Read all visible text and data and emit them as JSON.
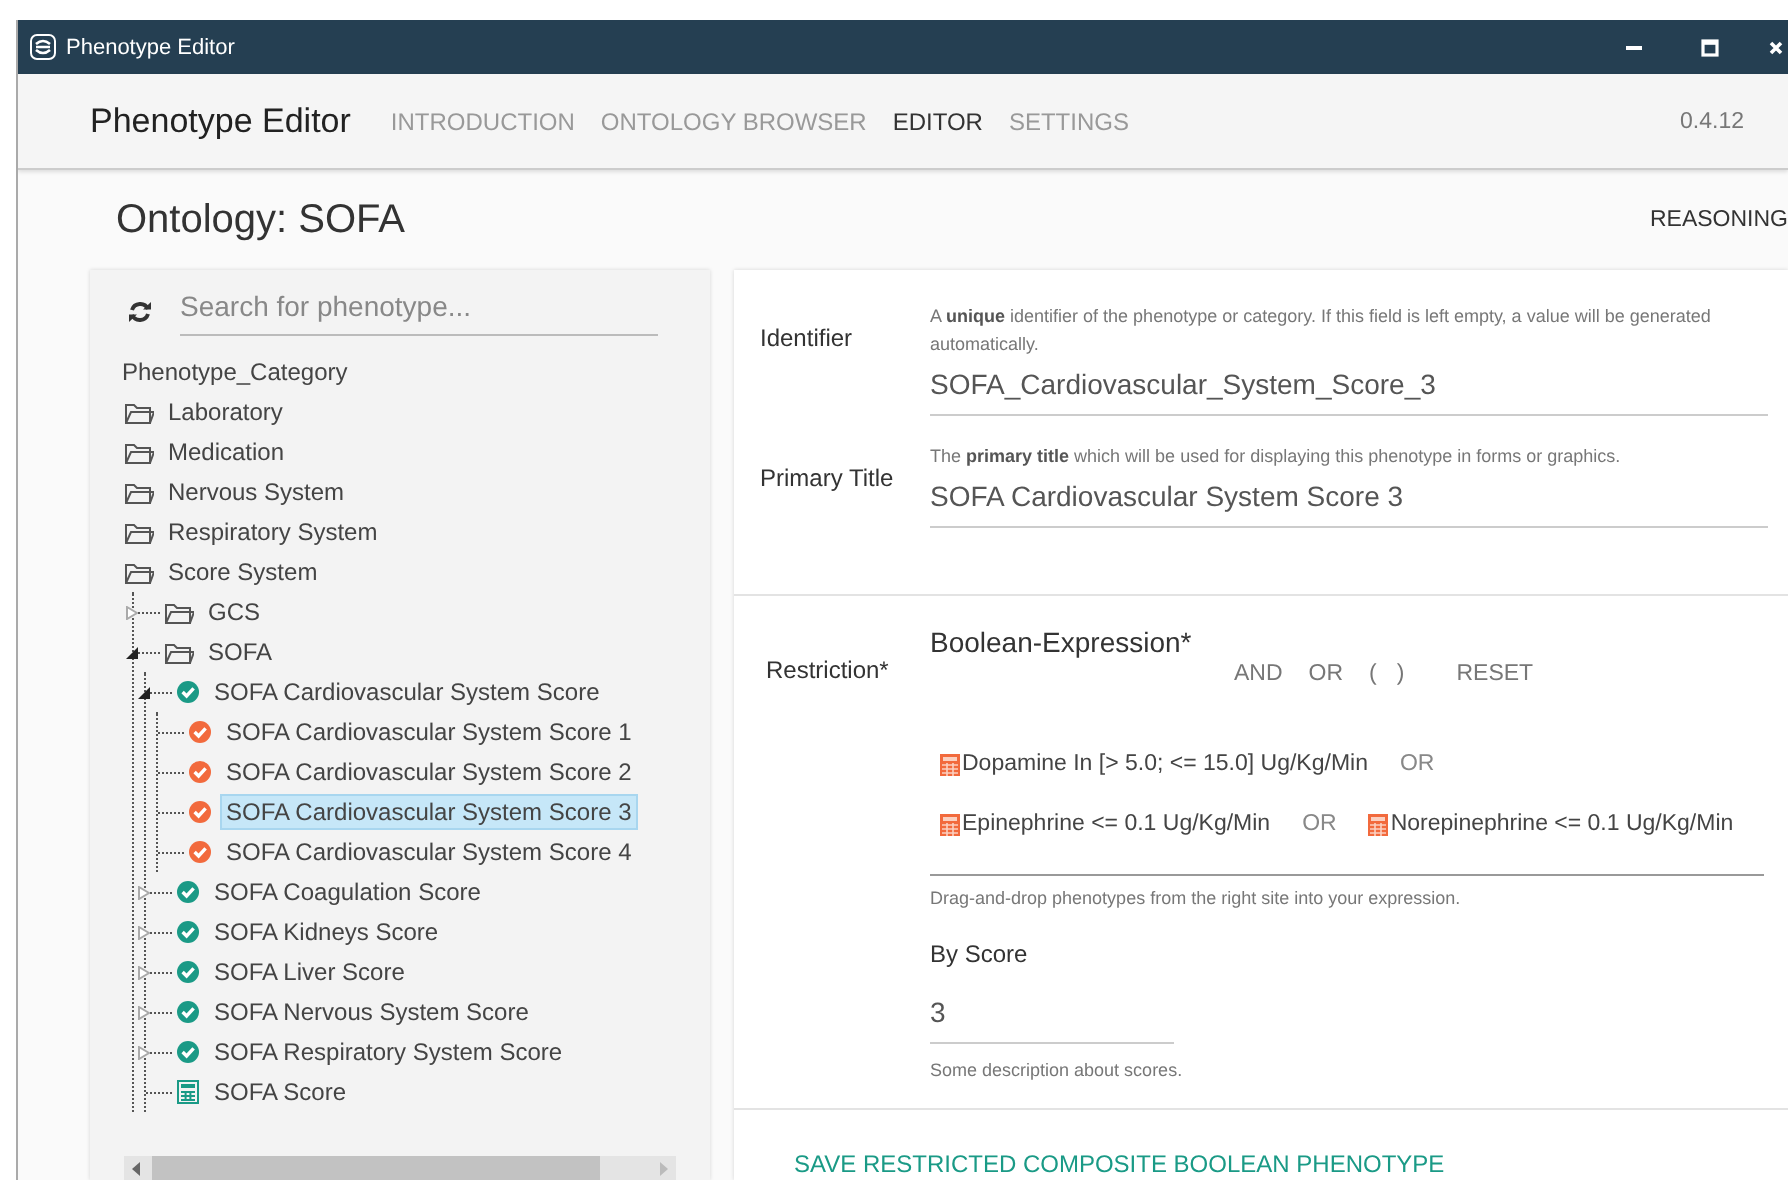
{
  "window": {
    "title": "Phenotype Editor"
  },
  "navbar": {
    "brand": "Phenotype Editor",
    "tabs": [
      {
        "label": "INTRODUCTION",
        "selected": false
      },
      {
        "label": "ONTOLOGY BROWSER",
        "selected": false
      },
      {
        "label": "EDITOR",
        "selected": true
      },
      {
        "label": "SETTINGS",
        "selected": false
      }
    ],
    "version": "0.4.12"
  },
  "page": {
    "title": "Ontology: SOFA",
    "action": "REASONING"
  },
  "sidebar": {
    "search": {
      "placeholder": "Search for phenotype..."
    },
    "root": "Phenotype_Category",
    "tree": [
      {
        "label": "Laboratory",
        "kind": "folder",
        "selected": false
      },
      {
        "label": "Medication",
        "kind": "folder",
        "selected": false
      },
      {
        "label": "Nervous System",
        "kind": "folder",
        "selected": false
      },
      {
        "label": "Respiratory System",
        "kind": "folder",
        "selected": false
      },
      {
        "label": "Score System",
        "kind": "folder",
        "selected": false,
        "children": [
          {
            "label": "GCS",
            "kind": "folder",
            "selected": false,
            "expanded": false
          },
          {
            "label": "SOFA",
            "kind": "folder",
            "selected": false,
            "expanded": true,
            "children": [
              {
                "label": "SOFA Cardiovascular System Score",
                "kind": "category",
                "selected": false,
                "expanded": true,
                "children": [
                  {
                    "label": "SOFA Cardiovascular System Score 1",
                    "kind": "restricted",
                    "selected": false
                  },
                  {
                    "label": "SOFA Cardiovascular System Score 2",
                    "kind": "restricted",
                    "selected": false
                  },
                  {
                    "label": "SOFA Cardiovascular System Score 3",
                    "kind": "restricted",
                    "selected": true
                  },
                  {
                    "label": "SOFA Cardiovascular System Score 4",
                    "kind": "restricted",
                    "selected": false
                  }
                ]
              },
              {
                "label": "SOFA Coagulation Score",
                "kind": "category",
                "selected": false,
                "expanded": false
              },
              {
                "label": "SOFA Kidneys Score",
                "kind": "category",
                "selected": false,
                "expanded": false
              },
              {
                "label": "SOFA Liver Score",
                "kind": "category",
                "selected": false,
                "expanded": false
              },
              {
                "label": "SOFA Nervous System Score",
                "kind": "category",
                "selected": false,
                "expanded": false
              },
              {
                "label": "SOFA Respiratory System Score",
                "kind": "category",
                "selected": false,
                "expanded": false
              },
              {
                "label": "SOFA Score",
                "kind": "calculation",
                "selected": false
              }
            ]
          }
        ]
      }
    ]
  },
  "form": {
    "identifier": {
      "label": "Identifier",
      "help": "A **unique** identifier of the phenotype or category. If this field is left empty, a value will be generated automatically.",
      "value": "SOFA_Cardiovascular_System_Score_3"
    },
    "primary_title": {
      "label": "Primary Title",
      "help": "The **primary title** which will be used for displaying this phenotype in forms or graphics.",
      "value": "SOFA Cardiovascular System Score 3"
    },
    "restriction": {
      "label": "Restriction*",
      "heading": "Boolean-Expression*",
      "operators": [
        "AND",
        "OR",
        "(",
        ")",
        "RESET"
      ],
      "expression": [
        [
          {
            "kind": "phenotype",
            "text": "Dopamine In [> 5.0; <= 15.0] Ug/Kg/Min"
          },
          {
            "kind": "operator",
            "text": "OR"
          }
        ],
        [
          {
            "kind": "phenotype",
            "text": "Epinephrine <= 0.1 Ug/Kg/Min"
          },
          {
            "kind": "operator",
            "text": "OR"
          },
          {
            "kind": "phenotype",
            "text": "Norepinephrine <= 0.1 Ug/Kg/Min"
          }
        ]
      ],
      "hint": "Drag-and-drop phenotypes from the right site into your expression.",
      "score_label": "By Score",
      "score_value": "3",
      "score_hint": "Some description about scores."
    },
    "save_button": "SAVE RESTRICTED COMPOSITE BOOLEAN PHENOTYPE"
  }
}
